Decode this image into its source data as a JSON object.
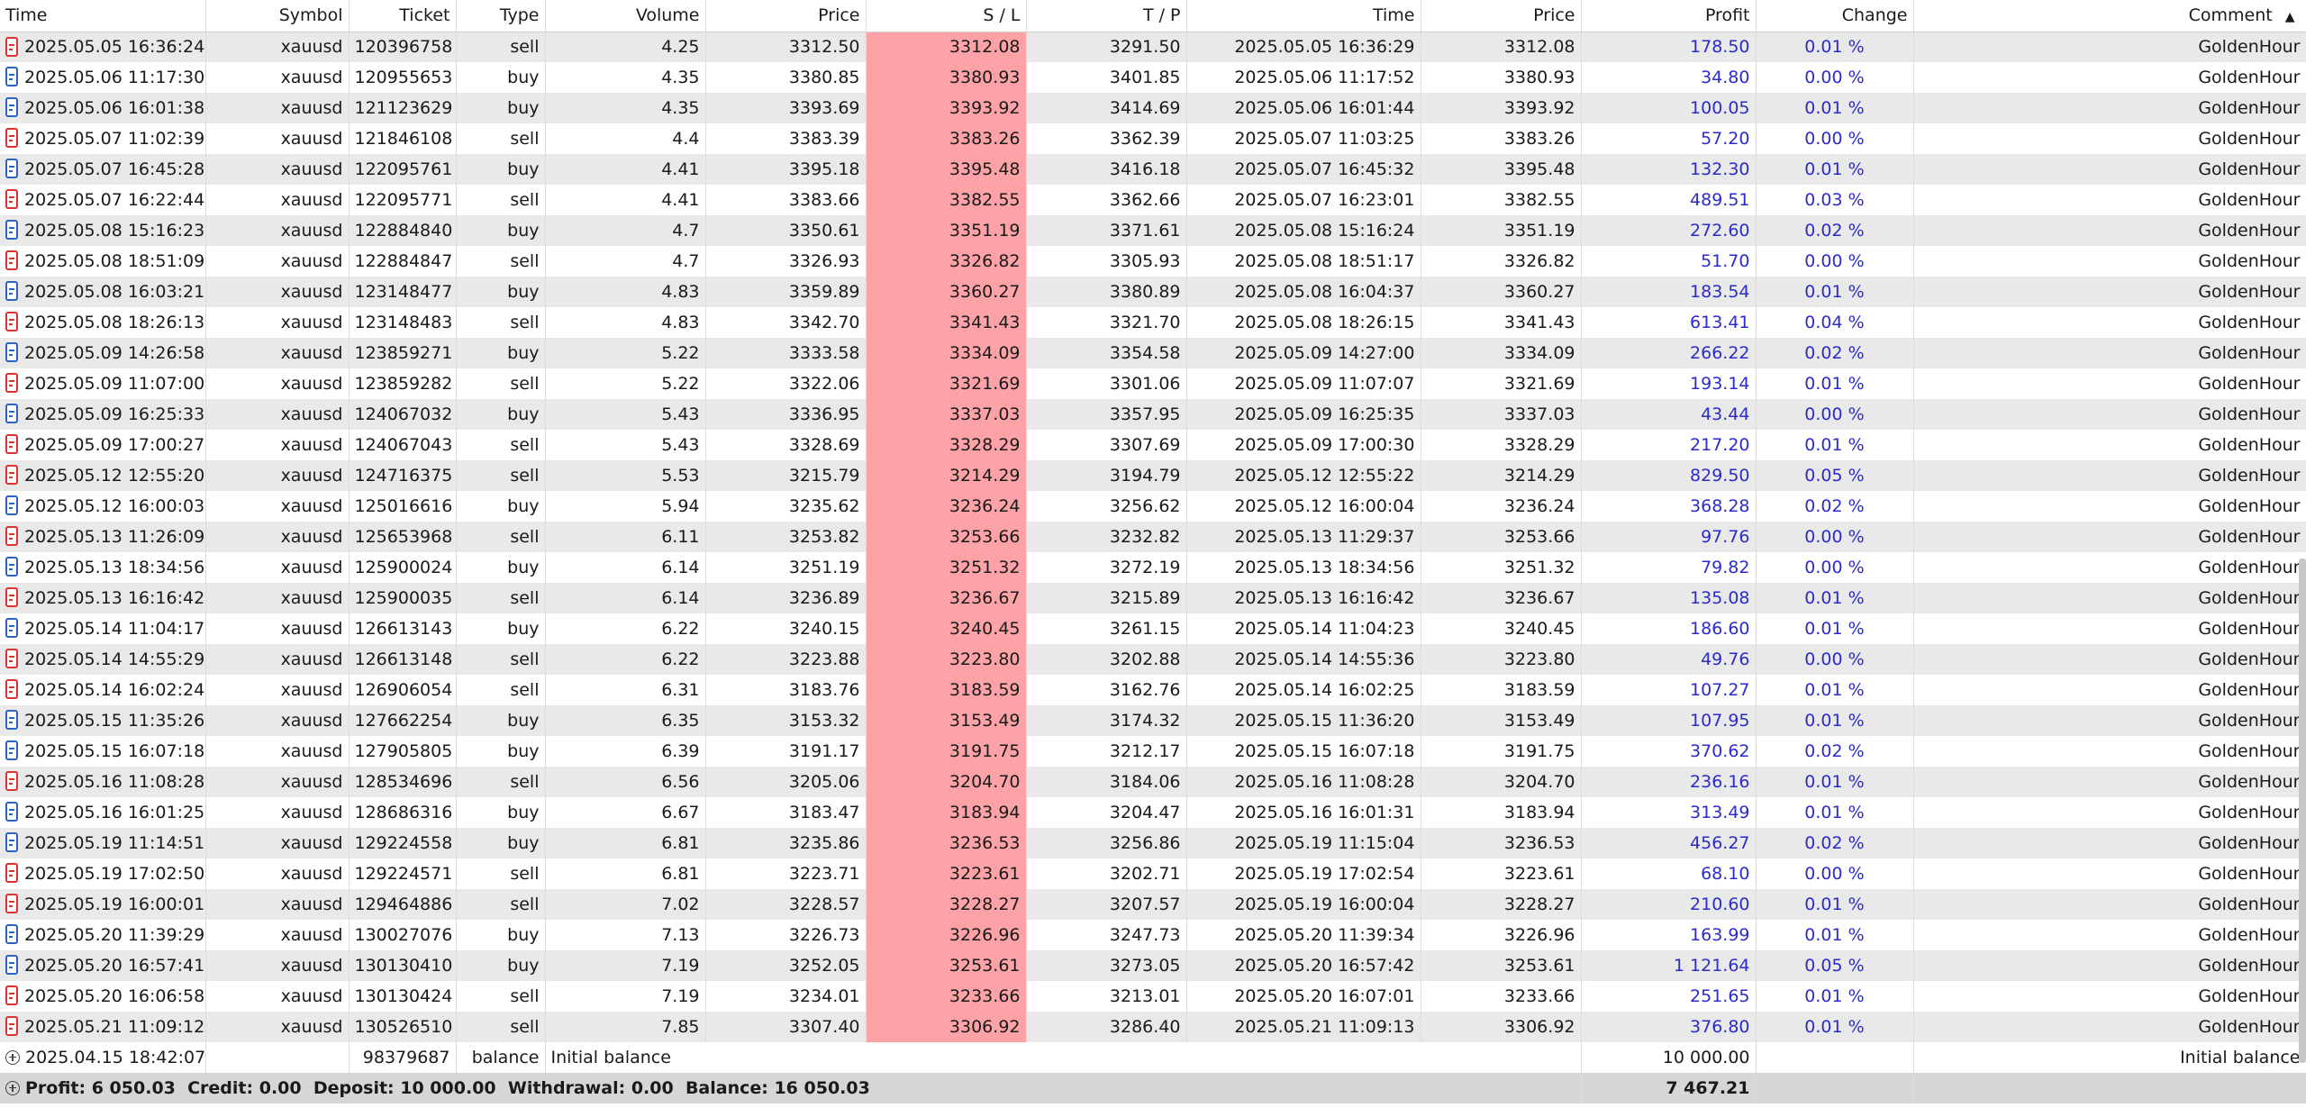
{
  "columns": [
    "Time",
    "Symbol",
    "Ticket",
    "Type",
    "Volume",
    "Price",
    "S / L",
    "T / P",
    "Time",
    "Price",
    "Profit",
    "Change",
    "Comment"
  ],
  "sort_indicator": "▲",
  "deals": [
    {
      "time": "2025.05.05 16:36:24",
      "symbol": "xauusd",
      "ticket": "120396758",
      "type": "sell",
      "volume": "4.25",
      "price": "3312.50",
      "sl": "3312.08",
      "tp": "3291.50",
      "close_time": "2025.05.05 16:36:29",
      "close_price": "3312.08",
      "profit": "178.50",
      "change": "0.01 %",
      "comment": "GoldenHour"
    },
    {
      "time": "2025.05.06 11:17:30",
      "symbol": "xauusd",
      "ticket": "120955653",
      "type": "buy",
      "volume": "4.35",
      "price": "3380.85",
      "sl": "3380.93",
      "tp": "3401.85",
      "close_time": "2025.05.06 11:17:52",
      "close_price": "3380.93",
      "profit": "34.80",
      "change": "0.00 %",
      "comment": "GoldenHour"
    },
    {
      "time": "2025.05.06 16:01:38",
      "symbol": "xauusd",
      "ticket": "121123629",
      "type": "buy",
      "volume": "4.35",
      "price": "3393.69",
      "sl": "3393.92",
      "tp": "3414.69",
      "close_time": "2025.05.06 16:01:44",
      "close_price": "3393.92",
      "profit": "100.05",
      "change": "0.01 %",
      "comment": "GoldenHour"
    },
    {
      "time": "2025.05.07 11:02:39",
      "symbol": "xauusd",
      "ticket": "121846108",
      "type": "sell",
      "volume": "4.4",
      "price": "3383.39",
      "sl": "3383.26",
      "tp": "3362.39",
      "close_time": "2025.05.07 11:03:25",
      "close_price": "3383.26",
      "profit": "57.20",
      "change": "0.00 %",
      "comment": "GoldenHour"
    },
    {
      "time": "2025.05.07 16:45:28",
      "symbol": "xauusd",
      "ticket": "122095761",
      "type": "buy",
      "volume": "4.41",
      "price": "3395.18",
      "sl": "3395.48",
      "tp": "3416.18",
      "close_time": "2025.05.07 16:45:32",
      "close_price": "3395.48",
      "profit": "132.30",
      "change": "0.01 %",
      "comment": "GoldenHour"
    },
    {
      "time": "2025.05.07 16:22:44",
      "symbol": "xauusd",
      "ticket": "122095771",
      "type": "sell",
      "volume": "4.41",
      "price": "3383.66",
      "sl": "3382.55",
      "tp": "3362.66",
      "close_time": "2025.05.07 16:23:01",
      "close_price": "3382.55",
      "profit": "489.51",
      "change": "0.03 %",
      "comment": "GoldenHour"
    },
    {
      "time": "2025.05.08 15:16:23",
      "symbol": "xauusd",
      "ticket": "122884840",
      "type": "buy",
      "volume": "4.7",
      "price": "3350.61",
      "sl": "3351.19",
      "tp": "3371.61",
      "close_time": "2025.05.08 15:16:24",
      "close_price": "3351.19",
      "profit": "272.60",
      "change": "0.02 %",
      "comment": "GoldenHour"
    },
    {
      "time": "2025.05.08 18:51:09",
      "symbol": "xauusd",
      "ticket": "122884847",
      "type": "sell",
      "volume": "4.7",
      "price": "3326.93",
      "sl": "3326.82",
      "tp": "3305.93",
      "close_time": "2025.05.08 18:51:17",
      "close_price": "3326.82",
      "profit": "51.70",
      "change": "0.00 %",
      "comment": "GoldenHour"
    },
    {
      "time": "2025.05.08 16:03:21",
      "symbol": "xauusd",
      "ticket": "123148477",
      "type": "buy",
      "volume": "4.83",
      "price": "3359.89",
      "sl": "3360.27",
      "tp": "3380.89",
      "close_time": "2025.05.08 16:04:37",
      "close_price": "3360.27",
      "profit": "183.54",
      "change": "0.01 %",
      "comment": "GoldenHour"
    },
    {
      "time": "2025.05.08 18:26:13",
      "symbol": "xauusd",
      "ticket": "123148483",
      "type": "sell",
      "volume": "4.83",
      "price": "3342.70",
      "sl": "3341.43",
      "tp": "3321.70",
      "close_time": "2025.05.08 18:26:15",
      "close_price": "3341.43",
      "profit": "613.41",
      "change": "0.04 %",
      "comment": "GoldenHour"
    },
    {
      "time": "2025.05.09 14:26:58",
      "symbol": "xauusd",
      "ticket": "123859271",
      "type": "buy",
      "volume": "5.22",
      "price": "3333.58",
      "sl": "3334.09",
      "tp": "3354.58",
      "close_time": "2025.05.09 14:27:00",
      "close_price": "3334.09",
      "profit": "266.22",
      "change": "0.02 %",
      "comment": "GoldenHour"
    },
    {
      "time": "2025.05.09 11:07:00",
      "symbol": "xauusd",
      "ticket": "123859282",
      "type": "sell",
      "volume": "5.22",
      "price": "3322.06",
      "sl": "3321.69",
      "tp": "3301.06",
      "close_time": "2025.05.09 11:07:07",
      "close_price": "3321.69",
      "profit": "193.14",
      "change": "0.01 %",
      "comment": "GoldenHour"
    },
    {
      "time": "2025.05.09 16:25:33",
      "symbol": "xauusd",
      "ticket": "124067032",
      "type": "buy",
      "volume": "5.43",
      "price": "3336.95",
      "sl": "3337.03",
      "tp": "3357.95",
      "close_time": "2025.05.09 16:25:35",
      "close_price": "3337.03",
      "profit": "43.44",
      "change": "0.00 %",
      "comment": "GoldenHour"
    },
    {
      "time": "2025.05.09 17:00:27",
      "symbol": "xauusd",
      "ticket": "124067043",
      "type": "sell",
      "volume": "5.43",
      "price": "3328.69",
      "sl": "3328.29",
      "tp": "3307.69",
      "close_time": "2025.05.09 17:00:30",
      "close_price": "3328.29",
      "profit": "217.20",
      "change": "0.01 %",
      "comment": "GoldenHour"
    },
    {
      "time": "2025.05.12 12:55:20",
      "symbol": "xauusd",
      "ticket": "124716375",
      "type": "sell",
      "volume": "5.53",
      "price": "3215.79",
      "sl": "3214.29",
      "tp": "3194.79",
      "close_time": "2025.05.12 12:55:22",
      "close_price": "3214.29",
      "profit": "829.50",
      "change": "0.05 %",
      "comment": "GoldenHour"
    },
    {
      "time": "2025.05.12 16:00:03",
      "symbol": "xauusd",
      "ticket": "125016616",
      "type": "buy",
      "volume": "5.94",
      "price": "3235.62",
      "sl": "3236.24",
      "tp": "3256.62",
      "close_time": "2025.05.12 16:00:04",
      "close_price": "3236.24",
      "profit": "368.28",
      "change": "0.02 %",
      "comment": "GoldenHour"
    },
    {
      "time": "2025.05.13 11:26:09",
      "symbol": "xauusd",
      "ticket": "125653968",
      "type": "sell",
      "volume": "6.11",
      "price": "3253.82",
      "sl": "3253.66",
      "tp": "3232.82",
      "close_time": "2025.05.13 11:29:37",
      "close_price": "3253.66",
      "profit": "97.76",
      "change": "0.00 %",
      "comment": "GoldenHour"
    },
    {
      "time": "2025.05.13 18:34:56",
      "symbol": "xauusd",
      "ticket": "125900024",
      "type": "buy",
      "volume": "6.14",
      "price": "3251.19",
      "sl": "3251.32",
      "tp": "3272.19",
      "close_time": "2025.05.13 18:34:56",
      "close_price": "3251.32",
      "profit": "79.82",
      "change": "0.00 %",
      "comment": "GoldenHour"
    },
    {
      "time": "2025.05.13 16:16:42",
      "symbol": "xauusd",
      "ticket": "125900035",
      "type": "sell",
      "volume": "6.14",
      "price": "3236.89",
      "sl": "3236.67",
      "tp": "3215.89",
      "close_time": "2025.05.13 16:16:42",
      "close_price": "3236.67",
      "profit": "135.08",
      "change": "0.01 %",
      "comment": "GoldenHour"
    },
    {
      "time": "2025.05.14 11:04:17",
      "symbol": "xauusd",
      "ticket": "126613143",
      "type": "buy",
      "volume": "6.22",
      "price": "3240.15",
      "sl": "3240.45",
      "tp": "3261.15",
      "close_time": "2025.05.14 11:04:23",
      "close_price": "3240.45",
      "profit": "186.60",
      "change": "0.01 %",
      "comment": "GoldenHour"
    },
    {
      "time": "2025.05.14 14:55:29",
      "symbol": "xauusd",
      "ticket": "126613148",
      "type": "sell",
      "volume": "6.22",
      "price": "3223.88",
      "sl": "3223.80",
      "tp": "3202.88",
      "close_time": "2025.05.14 14:55:36",
      "close_price": "3223.80",
      "profit": "49.76",
      "change": "0.00 %",
      "comment": "GoldenHour"
    },
    {
      "time": "2025.05.14 16:02:24",
      "symbol": "xauusd",
      "ticket": "126906054",
      "type": "sell",
      "volume": "6.31",
      "price": "3183.76",
      "sl": "3183.59",
      "tp": "3162.76",
      "close_time": "2025.05.14 16:02:25",
      "close_price": "3183.59",
      "profit": "107.27",
      "change": "0.01 %",
      "comment": "GoldenHour"
    },
    {
      "time": "2025.05.15 11:35:26",
      "symbol": "xauusd",
      "ticket": "127662254",
      "type": "buy",
      "volume": "6.35",
      "price": "3153.32",
      "sl": "3153.49",
      "tp": "3174.32",
      "close_time": "2025.05.15 11:36:20",
      "close_price": "3153.49",
      "profit": "107.95",
      "change": "0.01 %",
      "comment": "GoldenHour"
    },
    {
      "time": "2025.05.15 16:07:18",
      "symbol": "xauusd",
      "ticket": "127905805",
      "type": "buy",
      "volume": "6.39",
      "price": "3191.17",
      "sl": "3191.75",
      "tp": "3212.17",
      "close_time": "2025.05.15 16:07:18",
      "close_price": "3191.75",
      "profit": "370.62",
      "change": "0.02 %",
      "comment": "GoldenHour"
    },
    {
      "time": "2025.05.16 11:08:28",
      "symbol": "xauusd",
      "ticket": "128534696",
      "type": "sell",
      "volume": "6.56",
      "price": "3205.06",
      "sl": "3204.70",
      "tp": "3184.06",
      "close_time": "2025.05.16 11:08:28",
      "close_price": "3204.70",
      "profit": "236.16",
      "change": "0.01 %",
      "comment": "GoldenHour"
    },
    {
      "time": "2025.05.16 16:01:25",
      "symbol": "xauusd",
      "ticket": "128686316",
      "type": "buy",
      "volume": "6.67",
      "price": "3183.47",
      "sl": "3183.94",
      "tp": "3204.47",
      "close_time": "2025.05.16 16:01:31",
      "close_price": "3183.94",
      "profit": "313.49",
      "change": "0.01 %",
      "comment": "GoldenHour"
    },
    {
      "time": "2025.05.19 11:14:51",
      "symbol": "xauusd",
      "ticket": "129224558",
      "type": "buy",
      "volume": "6.81",
      "price": "3235.86",
      "sl": "3236.53",
      "tp": "3256.86",
      "close_time": "2025.05.19 11:15:04",
      "close_price": "3236.53",
      "profit": "456.27",
      "change": "0.02 %",
      "comment": "GoldenHour"
    },
    {
      "time": "2025.05.19 17:02:50",
      "symbol": "xauusd",
      "ticket": "129224571",
      "type": "sell",
      "volume": "6.81",
      "price": "3223.71",
      "sl": "3223.61",
      "tp": "3202.71",
      "close_time": "2025.05.19 17:02:54",
      "close_price": "3223.61",
      "profit": "68.10",
      "change": "0.00 %",
      "comment": "GoldenHour"
    },
    {
      "time": "2025.05.19 16:00:01",
      "symbol": "xauusd",
      "ticket": "129464886",
      "type": "sell",
      "volume": "7.02",
      "price": "3228.57",
      "sl": "3228.27",
      "tp": "3207.57",
      "close_time": "2025.05.19 16:00:04",
      "close_price": "3228.27",
      "profit": "210.60",
      "change": "0.01 %",
      "comment": "GoldenHour"
    },
    {
      "time": "2025.05.20 11:39:29",
      "symbol": "xauusd",
      "ticket": "130027076",
      "type": "buy",
      "volume": "7.13",
      "price": "3226.73",
      "sl": "3226.96",
      "tp": "3247.73",
      "close_time": "2025.05.20 11:39:34",
      "close_price": "3226.96",
      "profit": "163.99",
      "change": "0.01 %",
      "comment": "GoldenHour"
    },
    {
      "time": "2025.05.20 16:57:41",
      "symbol": "xauusd",
      "ticket": "130130410",
      "type": "buy",
      "volume": "7.19",
      "price": "3252.05",
      "sl": "3253.61",
      "tp": "3273.05",
      "close_time": "2025.05.20 16:57:42",
      "close_price": "3253.61",
      "profit": "1 121.64",
      "change": "0.05 %",
      "comment": "GoldenHour"
    },
    {
      "time": "2025.05.20 16:06:58",
      "symbol": "xauusd",
      "ticket": "130130424",
      "type": "sell",
      "volume": "7.19",
      "price": "3234.01",
      "sl": "3233.66",
      "tp": "3213.01",
      "close_time": "2025.05.20 16:07:01",
      "close_price": "3233.66",
      "profit": "251.65",
      "change": "0.01 %",
      "comment": "GoldenHour"
    },
    {
      "time": "2025.05.21 11:09:12",
      "symbol": "xauusd",
      "ticket": "130526510",
      "type": "sell",
      "volume": "7.85",
      "price": "3307.40",
      "sl": "3306.92",
      "tp": "3286.40",
      "close_time": "2025.05.21 11:09:13",
      "close_price": "3306.92",
      "profit": "376.80",
      "change": "0.01 %",
      "comment": "GoldenHour"
    }
  ],
  "balance_row": {
    "time": "2025.04.15 18:42:07",
    "ticket": "98379687",
    "type": "balance",
    "description": "Initial balance",
    "amount": "10 000.00",
    "comment": "Initial balance"
  },
  "summary": {
    "text": "Profit: 6 050.03  Credit: 0.00  Deposit: 10 000.00  Withdrawal: 0.00  Balance: 16 050.03",
    "total_profit": "7 467.21"
  },
  "colors": {
    "sl_highlight": "#fda3a8",
    "profit_text": "#2b2bcc",
    "sell_icon": "#e03030",
    "buy_icon": "#2a63c4",
    "row_alt": "#e9e9e9",
    "summary_bg": "#d6d6d6"
  },
  "icons": {
    "sell": "sell-deal-icon",
    "buy": "buy-deal-icon",
    "balance": "add-circle-icon"
  }
}
